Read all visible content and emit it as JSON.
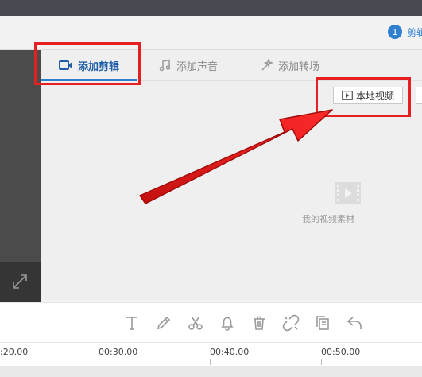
{
  "header": {
    "notice_count": "1",
    "notice_text": "剪辑"
  },
  "tabs": [
    {
      "label": "添加剪辑",
      "icon": "video-camera-icon",
      "active": true
    },
    {
      "label": "添加声音",
      "icon": "music-note-icon",
      "active": false
    },
    {
      "label": "添加转场",
      "icon": "transition-star-icon",
      "active": false
    }
  ],
  "media": {
    "local_video_button": "本地视频",
    "empty_label": "我的视频素材"
  },
  "toolbar": {
    "tools": [
      "text-icon",
      "pencil-icon",
      "scissors-icon",
      "bell-icon",
      "trash-icon",
      "unlink-icon",
      "copy-icon",
      "undo-icon"
    ]
  },
  "timeline": {
    "ticks": [
      ":20.00",
      "00:30.00",
      "00:40.00",
      "00:50.00"
    ]
  },
  "colors": {
    "accent": "#2f7fd1",
    "highlight_red": "#e62020"
  }
}
